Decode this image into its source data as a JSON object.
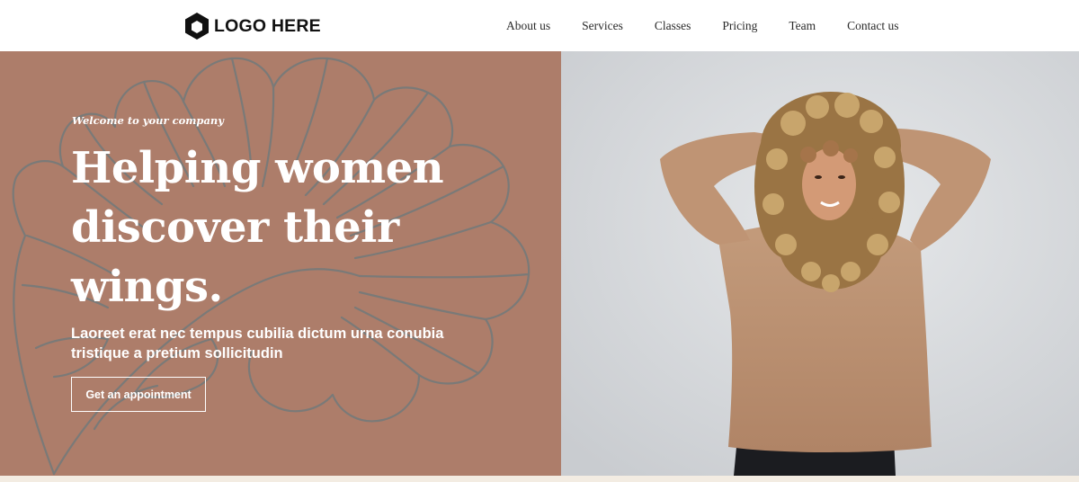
{
  "header": {
    "logo_text": "LOGO HERE",
    "logo_icon": "hexagon-logo-icon",
    "nav": [
      "About us",
      "Services",
      "Classes",
      "Pricing",
      "Team",
      "Contact us"
    ]
  },
  "hero": {
    "eyebrow": "Welcome to your company",
    "headline": "Helping women discover their wings.",
    "subtext": "Laoreet erat nec tempus cubilia dictum urna conubia tristique a pretium sollicitudin",
    "cta_label": "Get an appointment",
    "decor_icon": "monstera-leaf-outline",
    "photo": "woman-curly-hair-beige-sweater"
  },
  "colors": {
    "hero_background": "#ad7d6a",
    "leaf_outline": "#7a7a78",
    "text_on_hero": "#ffffff",
    "photo_backdrop": "#d9dcdf",
    "sweater": "#bc9272",
    "bottom_strip": "#f3ece2"
  }
}
